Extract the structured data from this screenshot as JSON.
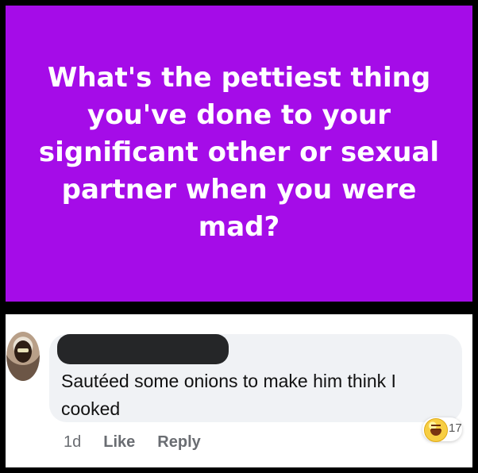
{
  "post": {
    "text": "What's the pettiest thing you've done to your significant other or sexual partner when you were mad?",
    "background": "#a50ce8"
  },
  "comment": {
    "text": "Sautéed some onions to make him think I cooked",
    "time": "1d",
    "like_label": "Like",
    "reply_label": "Reply",
    "reaction_icon": "laughing-reaction-icon",
    "reaction_count": "17"
  },
  "colors": {
    "frame": "#000000",
    "comment_bubble": "#f0f2f5"
  }
}
